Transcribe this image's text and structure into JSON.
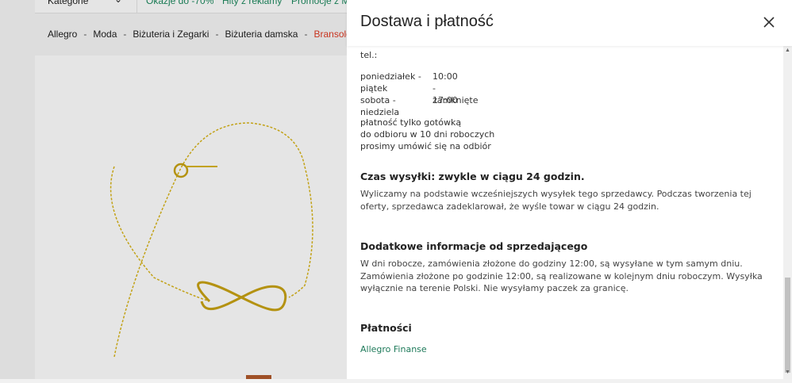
{
  "background": {
    "category_select": "Kategorie",
    "promos": [
      "Okazje do -70%",
      "Hity z reklamy",
      "Promocje z Mo"
    ],
    "breadcrumb": [
      "Allegro",
      "Moda",
      "Biżuteria i Zegarki",
      "Biżuteria damska",
      "Bransoletki"
    ]
  },
  "panel": {
    "title": "Dostawa i płatność",
    "cut_text": "tel.:",
    "hours": [
      {
        "day": "poniedziałek -",
        "day2": "piątek",
        "time": "10:00 - 17:00"
      },
      {
        "day": "sobota - niedziela",
        "time": "zamknięte"
      }
    ],
    "pickup_notes": [
      "płatność tylko gotówką",
      "do odbioru w 10 dni roboczych",
      "prosimy umówić się na odbiór"
    ],
    "shipping_time": {
      "heading": "Czas wysyłki: zwykle w ciągu 24 godzin.",
      "text": "Wyliczamy na podstawie wcześniejszych wysyłek tego sprzedawcy. Podczas tworzenia tej oferty, sprzedawca zadeklarował, że wyśle towar w ciągu 24 godzin."
    },
    "seller_info": {
      "heading": "Dodatkowe informacje od sprzedającego",
      "text": "W dni robocze, zamówienia złożone do godziny 12:00, są wysyłane w tym samym dniu. Zamówienia złożone po godzinie 12:00, są realizowane w kolejnym dniu roboczym. Wysyłka wyłącznie na terenie Polski. Nie wysyłamy paczek za granicę."
    },
    "payments": {
      "heading": "Płatności",
      "link": "Allegro Finanse"
    }
  },
  "colors": {
    "accent": "#1e7a5a",
    "breadcrumb_current": "#e03b24",
    "gold": "#d9b51a"
  }
}
